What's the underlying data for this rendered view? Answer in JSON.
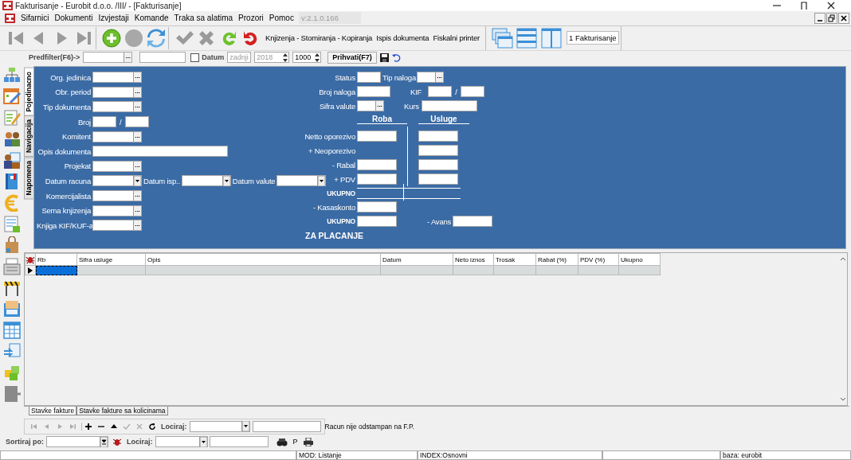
{
  "window": {
    "title": "Fakturisanje - Eurobit d.o.o. /III/ - [Fakturisanje]"
  },
  "menu": {
    "items": [
      "Sifarnici",
      "Dokumenti",
      "Izvjestaji",
      "Komande",
      "Traka sa alatima",
      "Prozori",
      "Pomoc"
    ],
    "version": "v:2.1.0.166"
  },
  "toolbar": {
    "actions": [
      "Knjizenja - Stomiranja - Kopiranja",
      "Ispis dokumenta",
      "Fiskalni printer"
    ],
    "window_tab": "1 Fakturisanje"
  },
  "filter": {
    "label": "Predfilter(F6)->",
    "lookup_button": "...",
    "date_checkbox": {
      "label": "Datum",
      "checked": false
    },
    "period": "zadnji",
    "year": "2018",
    "date_disabled": true,
    "limit": "1000",
    "apply": "Prihvati(F7)"
  },
  "side_tabs": [
    {
      "label": "Pojedinacno",
      "selected": true
    },
    {
      "label": "Navigacija",
      "selected": false
    },
    {
      "label": "Napomena",
      "selected": false
    }
  ],
  "form": {
    "left": [
      {
        "parts": [
          {
            "kind": "label",
            "text": "Org. jedinica"
          },
          {
            "kind": "lookup",
            "button": "..."
          }
        ]
      },
      {
        "parts": [
          {
            "kind": "label",
            "text": "Obr. period"
          },
          {
            "kind": "lookup",
            "button": "..."
          }
        ]
      },
      {
        "parts": [
          {
            "kind": "label",
            "text": "Tip dokumenta"
          },
          {
            "kind": "lookup",
            "button": "..."
          }
        ]
      },
      {
        "parts": [
          {
            "kind": "label",
            "text": "Broj"
          },
          {
            "kind": "short"
          },
          {
            "kind": "sep",
            "text": "/"
          },
          {
            "kind": "short"
          }
        ]
      },
      {
        "parts": [
          {
            "kind": "label",
            "text": "Komitent"
          },
          {
            "kind": "lookup",
            "button": "..."
          }
        ]
      },
      {
        "parts": [
          {
            "kind": "label",
            "text": "Opis dokumenta"
          },
          {
            "kind": "wide"
          }
        ]
      },
      {
        "parts": [
          {
            "kind": "label",
            "text": "Projekat"
          },
          {
            "kind": "lookup",
            "button": "..."
          }
        ]
      },
      {
        "parts": [
          {
            "kind": "label",
            "text": "Datum racuna"
          },
          {
            "kind": "combo"
          },
          {
            "kind": "inline",
            "text": "Datum isp.."
          },
          {
            "kind": "combo"
          },
          {
            "kind": "inline",
            "text": "Datum valute"
          },
          {
            "kind": "combo"
          }
        ]
      },
      {
        "parts": [
          {
            "kind": "label",
            "text": "Komercijalista"
          },
          {
            "kind": "lookup",
            "button": "..."
          }
        ]
      },
      {
        "parts": [
          {
            "kind": "label",
            "text": "Sema knjizenja"
          },
          {
            "kind": "lookup",
            "button": "..."
          }
        ]
      },
      {
        "parts": [
          {
            "kind": "label",
            "text": "Knjiga KIF/KUF-a"
          },
          {
            "kind": "lookup",
            "button": "..."
          }
        ]
      }
    ],
    "right": [
      {
        "parts": [
          {
            "kind": "label",
            "text": "Status"
          },
          {
            "kind": "short"
          },
          {
            "kind": "inline",
            "text": "Tip naloga"
          },
          {
            "kind": "smalllookup",
            "button": "..."
          }
        ]
      },
      {
        "parts": [
          {
            "kind": "label",
            "text": "Broj naloga"
          },
          {
            "kind": "medium"
          },
          {
            "kind": "inline",
            "text": "KIF"
          },
          {
            "kind": "short"
          },
          {
            "kind": "sep",
            "text": "/"
          },
          {
            "kind": "short"
          }
        ]
      },
      {
        "parts": [
          {
            "kind": "label",
            "text": "Sifra valute"
          },
          {
            "kind": "smalllookup",
            "button": "..."
          },
          {
            "kind": "inline",
            "text": "Kurs"
          },
          {
            "kind": "long"
          }
        ]
      }
    ],
    "totals": {
      "columns": [
        "Roba",
        "Usluge"
      ],
      "rows": [
        {
          "label": "Netto oporezivo",
          "has_roba": true,
          "has_usluge": true
        },
        {
          "label": "+ Neoporezivo",
          "has_roba": false,
          "has_usluge": true
        },
        {
          "label": "- Rabal",
          "has_roba": true,
          "has_usluge": true
        },
        {
          "label": "+ PDV",
          "has_roba": true,
          "has_usluge": true
        }
      ],
      "sum_label": "UKUPNO",
      "discount_label": "- Kasaskonto",
      "total_label": "UKUPNO",
      "advance_label": "- Avans",
      "pay_label": "ZA PLACANJE"
    }
  },
  "table": {
    "columns": [
      "Rb",
      "Sifra usluge",
      "Opis",
      "Datum",
      "Neto iznos",
      "Trosak",
      "Rabat (%)",
      "PDV (%)",
      "Ukupno"
    ],
    "rows": [
      {
        "current": true
      }
    ]
  },
  "bottom_tabs": [
    {
      "label": "Stavke fakture",
      "selected": true
    },
    {
      "label": "Stavke fakture sa kolicinama",
      "selected": false
    }
  ],
  "nav_bar": {
    "locate_label": "Lociraj:",
    "message": "Racun nije odstampan na F.P."
  },
  "sort_bar": {
    "sort_label": "Sortiraj po:",
    "locate_label": "Lociraj:",
    "print_key": "P"
  },
  "status_bar": [
    {
      "kind": "blank"
    },
    {
      "kind": "text",
      "text": "MOD: Listanje"
    },
    {
      "kind": "text",
      "text": "INDEX:Osnovni"
    },
    {
      "kind": "blank"
    },
    {
      "kind": "text",
      "text": "baza: eurobit"
    }
  ]
}
